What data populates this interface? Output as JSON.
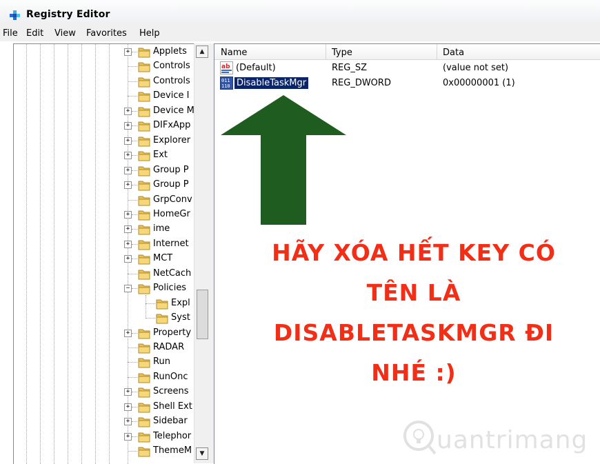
{
  "window": {
    "title": "Registry Editor"
  },
  "menu": {
    "file": "File",
    "edit": "Edit",
    "view": "View",
    "favorites": "Favorites",
    "help": "Help"
  },
  "tree": {
    "items": [
      {
        "label": "Applets",
        "expander": "+"
      },
      {
        "label": "Controls",
        "expander": ""
      },
      {
        "label": "Controls",
        "expander": ""
      },
      {
        "label": "Device I",
        "expander": ""
      },
      {
        "label": "Device M",
        "expander": "+"
      },
      {
        "label": "DIFxApp",
        "expander": "+"
      },
      {
        "label": "Explorer",
        "expander": "+"
      },
      {
        "label": "Ext",
        "expander": "+"
      },
      {
        "label": "Group P",
        "expander": "+"
      },
      {
        "label": "Group P",
        "expander": "+"
      },
      {
        "label": "GrpConv",
        "expander": ""
      },
      {
        "label": "HomeGr",
        "expander": "+"
      },
      {
        "label": "ime",
        "expander": "+"
      },
      {
        "label": "Internet",
        "expander": "+"
      },
      {
        "label": "MCT",
        "expander": "+"
      },
      {
        "label": "NetCach",
        "expander": ""
      },
      {
        "label": "Policies",
        "expander": "−"
      },
      {
        "label": "Expl",
        "expander": "",
        "child": true
      },
      {
        "label": "Syst",
        "expander": "",
        "child": true
      },
      {
        "label": "Property",
        "expander": "+"
      },
      {
        "label": "RADAR",
        "expander": ""
      },
      {
        "label": "Run",
        "expander": ""
      },
      {
        "label": "RunOnc",
        "expander": ""
      },
      {
        "label": "Screens",
        "expander": "+"
      },
      {
        "label": "Shell Ext",
        "expander": "+"
      },
      {
        "label": "Sidebar",
        "expander": "+"
      },
      {
        "label": "Telephor",
        "expander": "+"
      },
      {
        "label": "ThemeM",
        "expander": ""
      }
    ]
  },
  "list": {
    "headers": {
      "name": "Name",
      "type": "Type",
      "data": "Data"
    },
    "rows": [
      {
        "name": "(Default)",
        "type": "REG_SZ",
        "data": "(value not set)",
        "icon": "string-value-icon"
      },
      {
        "name": "DisableTaskMgr",
        "type": "REG_DWORD",
        "data": "0x00000001 (1)",
        "icon": "binary-value-icon",
        "selected": true
      }
    ]
  },
  "annotation": {
    "lines": [
      "HÃY XÓA HẾT KEY CÓ",
      "TÊN LÀ",
      "DISABLETASKMGR ĐI",
      "NHÉ :)"
    ],
    "color": "#f22e16",
    "arrow_color": "#1f5c1f"
  },
  "watermark": {
    "text": "uantrimang"
  }
}
